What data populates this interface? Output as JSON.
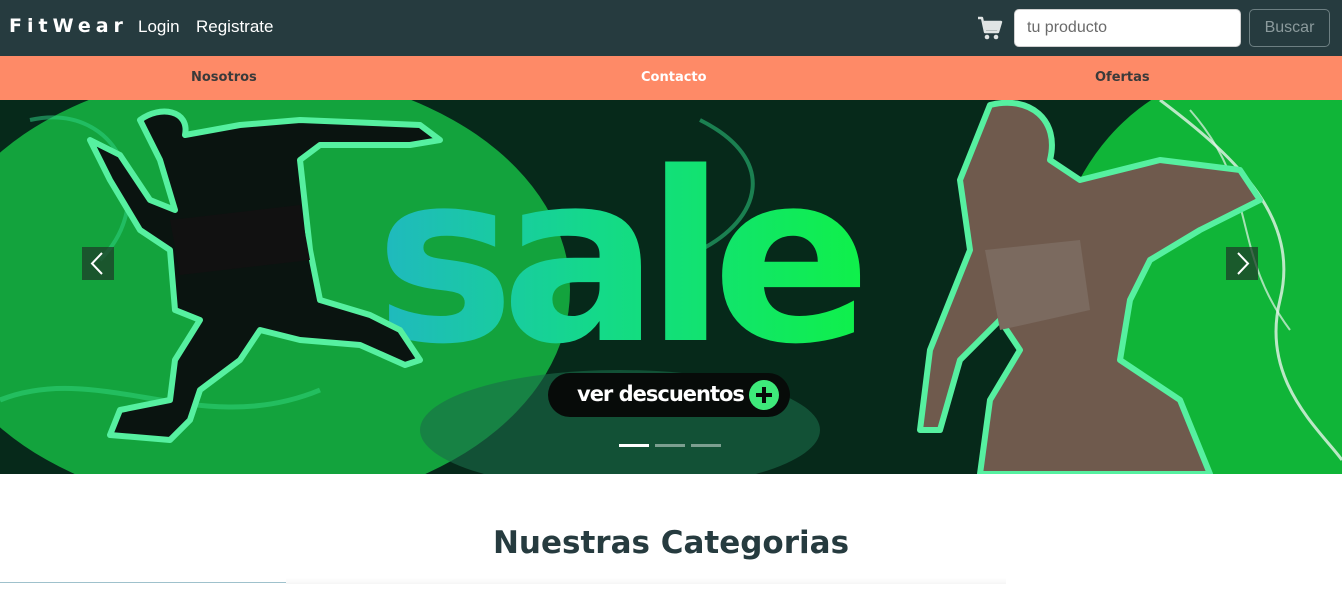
{
  "navbar": {
    "brand": "FitWear",
    "login": "Login",
    "register": "Registrate",
    "cart_icon": "shopping-cart-icon",
    "search": {
      "placeholder": "tu producto",
      "value": "",
      "button": "Buscar"
    }
  },
  "subnav": {
    "items": [
      "Nosotros",
      "Contacto",
      "Ofertas"
    ],
    "active": "Contacto"
  },
  "carousel": {
    "banner_text": "sale",
    "cta": "ver descuentos",
    "prev_icon": "chevron-left-icon",
    "next_icon": "chevron-right-icon",
    "slides": 3,
    "active_slide": 1
  },
  "categories": {
    "title": "Nuestras Categorias"
  },
  "colors": {
    "navbar_bg": "#263b3f",
    "subnav_bg": "#fe8a67",
    "accent_green": "#3ee97a",
    "title_color": "#263b3f"
  }
}
